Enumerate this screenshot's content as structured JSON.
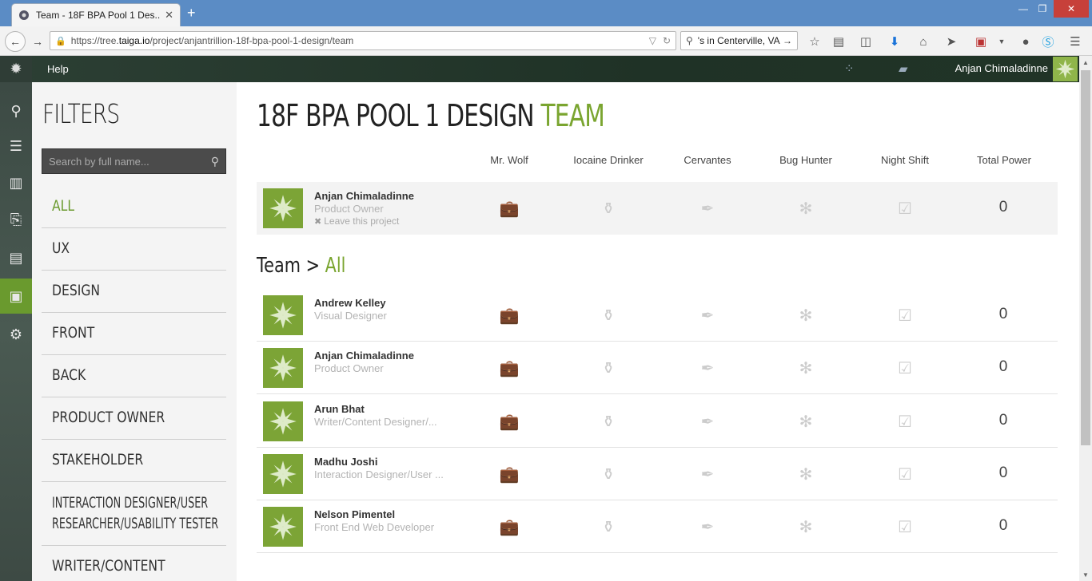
{
  "browser": {
    "tab_title": "Team - 18F BPA Pool 1 Des...",
    "url_prefix": "https://tree.",
    "url_domain": "taiga.io",
    "url_path": "/project/anjantrillion-18f-bpa-pool-1-design/team",
    "search_value": "'s in Centerville, VA"
  },
  "header": {
    "help_label": "Help",
    "username": "Anjan Chimaladinne"
  },
  "rail": [
    "search-icon",
    "backlog-icon",
    "kanban-icon",
    "issues-icon",
    "wiki-icon",
    "team-icon",
    "settings-icon"
  ],
  "filters": {
    "title": "FILTERS",
    "search_placeholder": "Search by full name...",
    "items": [
      "ALL",
      "UX",
      "DESIGN",
      "FRONT",
      "BACK",
      "PRODUCT OWNER",
      "STAKEHOLDER",
      "INTERACTION DESIGNER/USER RESEARCHER/USABILITY TESTER",
      "WRITER/CONTENT"
    ],
    "item_lines": {
      "interaction_1": "INTERACTION DESIGNER/USER",
      "interaction_2": "RESEARCHER/USABILITY TESTER"
    }
  },
  "main": {
    "title": "18F BPA POOL 1 DESIGN",
    "title_accent": "TEAM",
    "columns": [
      "Mr. Wolf",
      "Iocaine Drinker",
      "Cervantes",
      "Bug Hunter",
      "Night Shift",
      "Total Power"
    ],
    "me": {
      "name": "Anjan Chimaladinne",
      "role": "Product Owner",
      "leave_label": "Leave this project",
      "total": "0"
    },
    "team_heading": "Team >",
    "team_heading_accent": "All",
    "members": [
      {
        "name": "Andrew Kelley",
        "role": "Visual Designer",
        "total": "0"
      },
      {
        "name": "Anjan Chimaladinne",
        "role": "Product Owner",
        "total": "0"
      },
      {
        "name": "Arun Bhat",
        "role": "Writer/Content Designer/...",
        "total": "0"
      },
      {
        "name": "Madhu Joshi",
        "role": "Interaction Designer/User ...",
        "total": "0"
      },
      {
        "name": "Nelson Pimentel",
        "role": "Front End Web Developer",
        "total": "0"
      }
    ]
  }
}
